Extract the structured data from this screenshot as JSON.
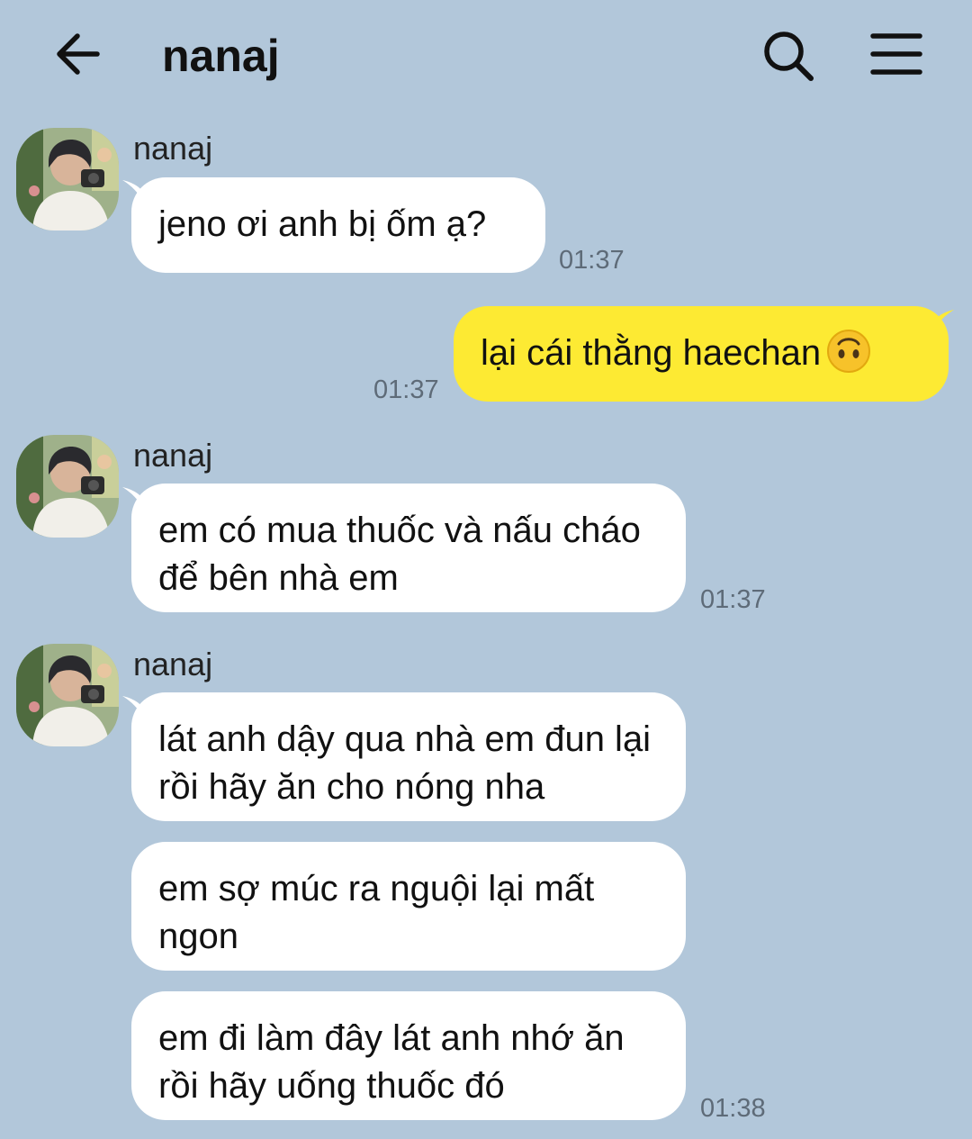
{
  "header": {
    "title": "nanaj",
    "back_icon": "back-arrow-icon",
    "search_icon": "search-icon",
    "menu_icon": "hamburger-menu-icon"
  },
  "colors": {
    "background": "#b2c7da",
    "incoming_bubble": "#ffffff",
    "outgoing_bubble": "#fdea33",
    "timestamp": "#5e6b78"
  },
  "messages": [
    {
      "sender": "nanaj",
      "direction": "incoming",
      "text": "jeno ơi anh bị ốm ạ?",
      "time": "01:37"
    },
    {
      "sender": "me",
      "direction": "outgoing",
      "text": "lại cái thằng haechan",
      "emoji": "upside-down-face",
      "time": "01:37"
    },
    {
      "sender": "nanaj",
      "direction": "incoming",
      "text": "em có mua thuốc và nấu cháo để bên nhà em",
      "time": "01:37"
    },
    {
      "sender": "nanaj",
      "direction": "incoming",
      "text": "lát anh dậy qua nhà em đun lại rồi hãy ăn cho nóng nha",
      "time": ""
    },
    {
      "sender": "nanaj",
      "direction": "incoming",
      "text": "em sợ múc ra nguội lại mất ngon",
      "time": ""
    },
    {
      "sender": "nanaj",
      "direction": "incoming",
      "text": "em đi làm đây lát anh nhớ ăn rồi hãy uống thuốc đó",
      "time": "01:38"
    }
  ]
}
